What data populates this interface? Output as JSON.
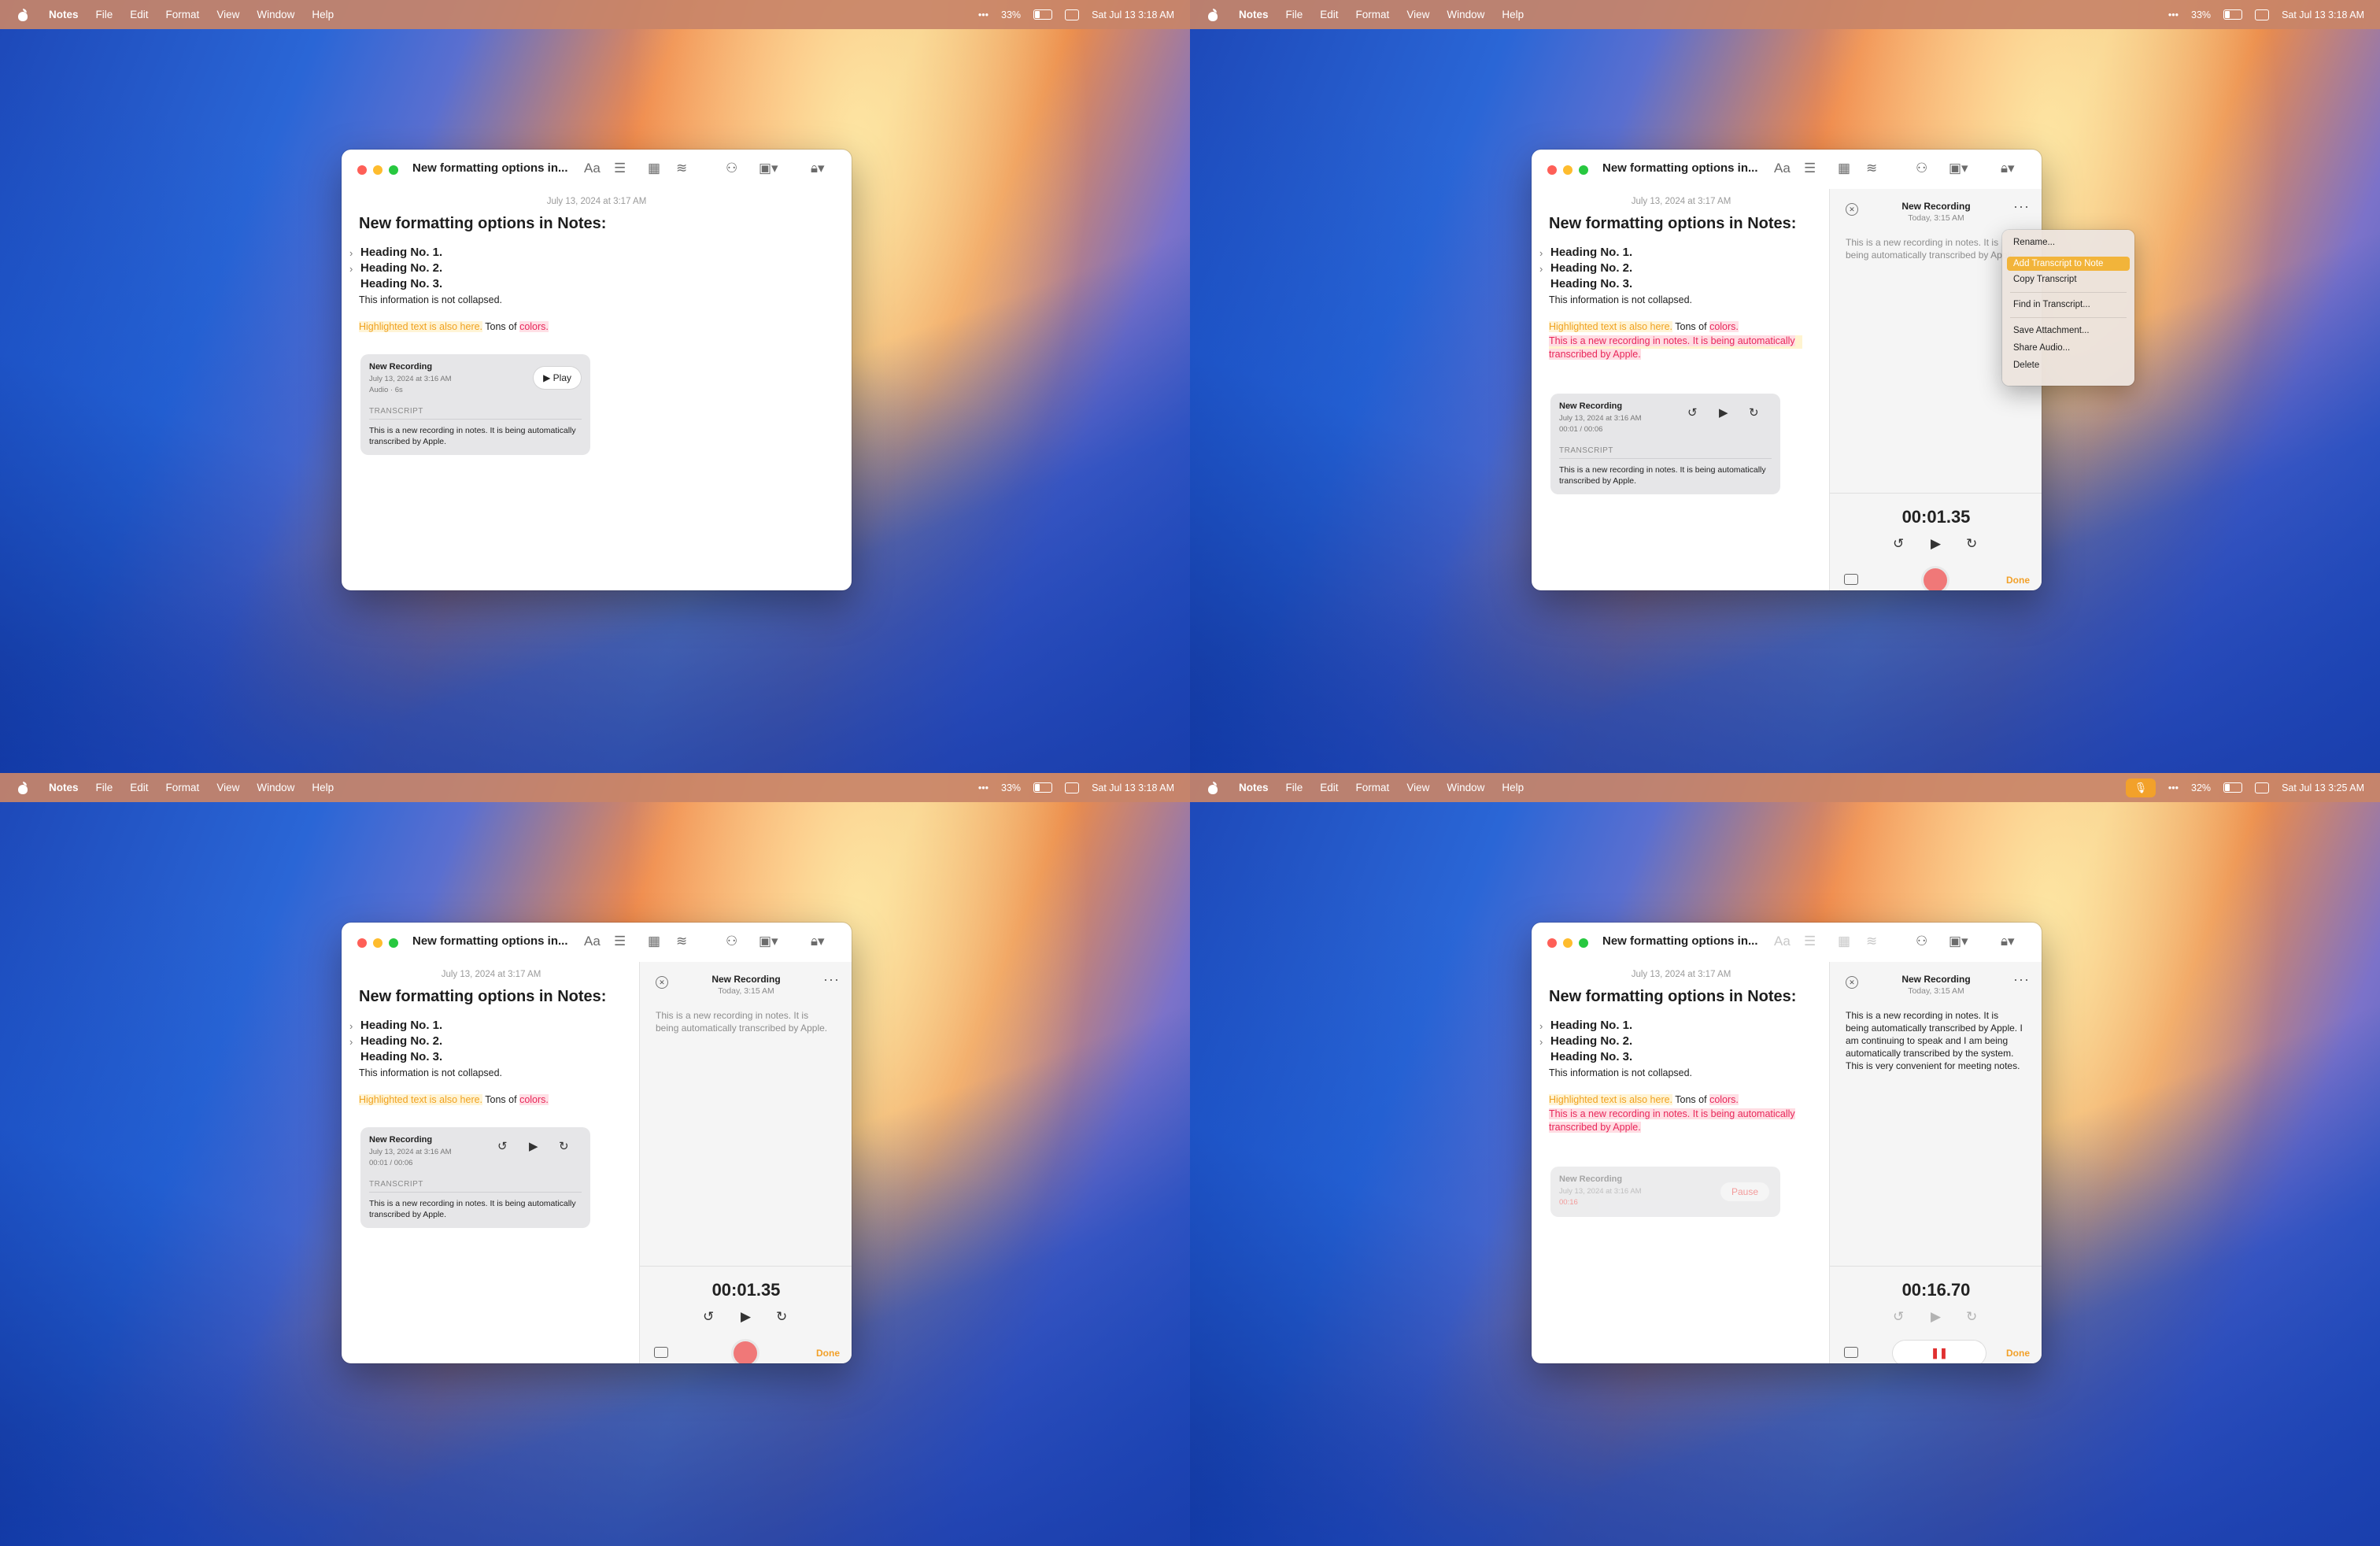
{
  "menubar": {
    "app": "Notes",
    "items": [
      "File",
      "Edit",
      "Format",
      "View",
      "Window",
      "Help"
    ],
    "battery": "33%",
    "battery_q4": "32%",
    "clock": "Sat Jul 13  3:18 AM",
    "clock_q4": "Sat Jul 13  3:25 AM",
    "more": "•••"
  },
  "window": {
    "title": "New formatting options in..."
  },
  "note": {
    "date": "July 13, 2024 at 3:17 AM",
    "title": "New formatting options in Notes:",
    "headings": [
      "Heading No. 1.",
      "Heading No. 2.",
      "Heading No. 3."
    ],
    "body": "This information is not collapsed.",
    "highlight_orange": "Highlighted text is also here.",
    "tons_of": " Tons of ",
    "highlight_pink": "colors.",
    "added_transcript": "This is a new recording in notes. It is being automatically transcribed by Apple."
  },
  "recording": {
    "title": "New Recording",
    "date": "July 13, 2024 at 3:16 AM",
    "meta": "Audio · 6s",
    "progress": "00:01 / 00:06",
    "elapsed_q4": "00:16",
    "play_label": "Play",
    "pause_label": "Pause",
    "transcript_label": "TRANSCRIPT",
    "transcript": "This is a new recording in notes. It is being automatically transcribed by Apple."
  },
  "panel": {
    "title": "New Recording",
    "subtitle": "Today, 3:15 AM",
    "transcript": "This is a new recording in notes. It is being automatically transcribed by Apple.",
    "transcript_long": "This is a new recording in notes. It is being automatically transcribed by Apple. I am continuing to speak and I am being automatically transcribed by the system. This is very convenient for meeting notes.",
    "timer": "00:01.35",
    "timer_q4": "00:16.70",
    "done": "Done"
  },
  "context_menu": {
    "items": [
      "Rename...",
      "Add Transcript to Note",
      "Copy Transcript",
      "Find in Transcript...",
      "Save Attachment...",
      "Share Audio...",
      "Delete"
    ]
  },
  "colors": {
    "accent": "#f2a12a",
    "record": "#f07878",
    "highlight_pink": "#e8275a",
    "highlight_orange": "#f0a21f"
  }
}
